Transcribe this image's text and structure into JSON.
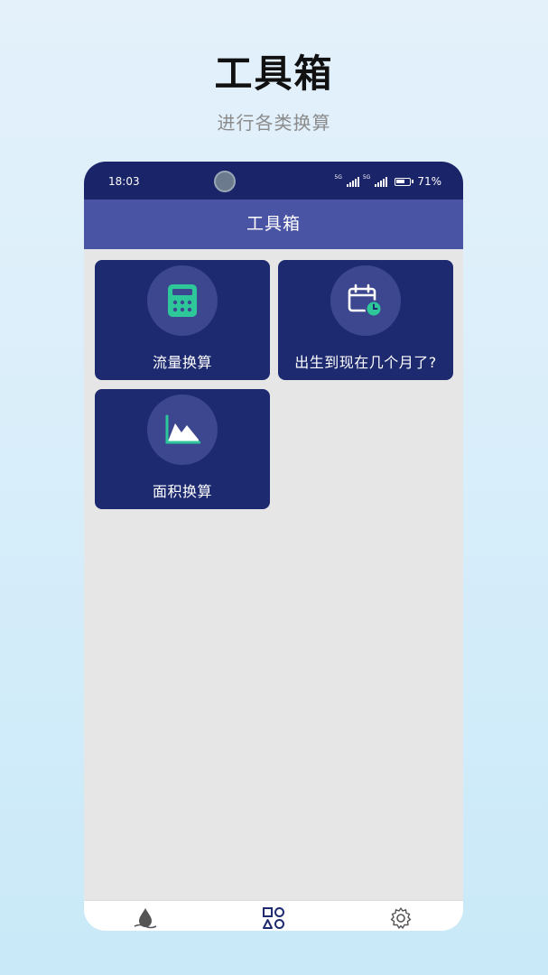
{
  "promo": {
    "title": "工具箱",
    "subtitle": "进行各类换算"
  },
  "status_bar": {
    "time": "18:03",
    "network1": "5G",
    "network2": "5G",
    "battery": "71%"
  },
  "app_bar": {
    "title": "工具箱"
  },
  "tools": [
    {
      "label": "流量换算",
      "icon": "calculator-icon"
    },
    {
      "label": "出生到现在几个月了?",
      "icon": "calendar-clock-icon"
    },
    {
      "label": "面积换算",
      "icon": "area-chart-icon"
    }
  ],
  "bottom_nav": {
    "items": [
      {
        "icon": "water-drop-icon",
        "active": false
      },
      {
        "icon": "tools-grid-icon",
        "active": true
      },
      {
        "icon": "settings-gear-icon",
        "active": false
      }
    ]
  },
  "colors": {
    "status_bar": "#1a2468",
    "app_bar": "#4a54a4",
    "card": "#1e2a70",
    "icon_circle": "#3c478f",
    "accent_green": "#2dc79a"
  }
}
